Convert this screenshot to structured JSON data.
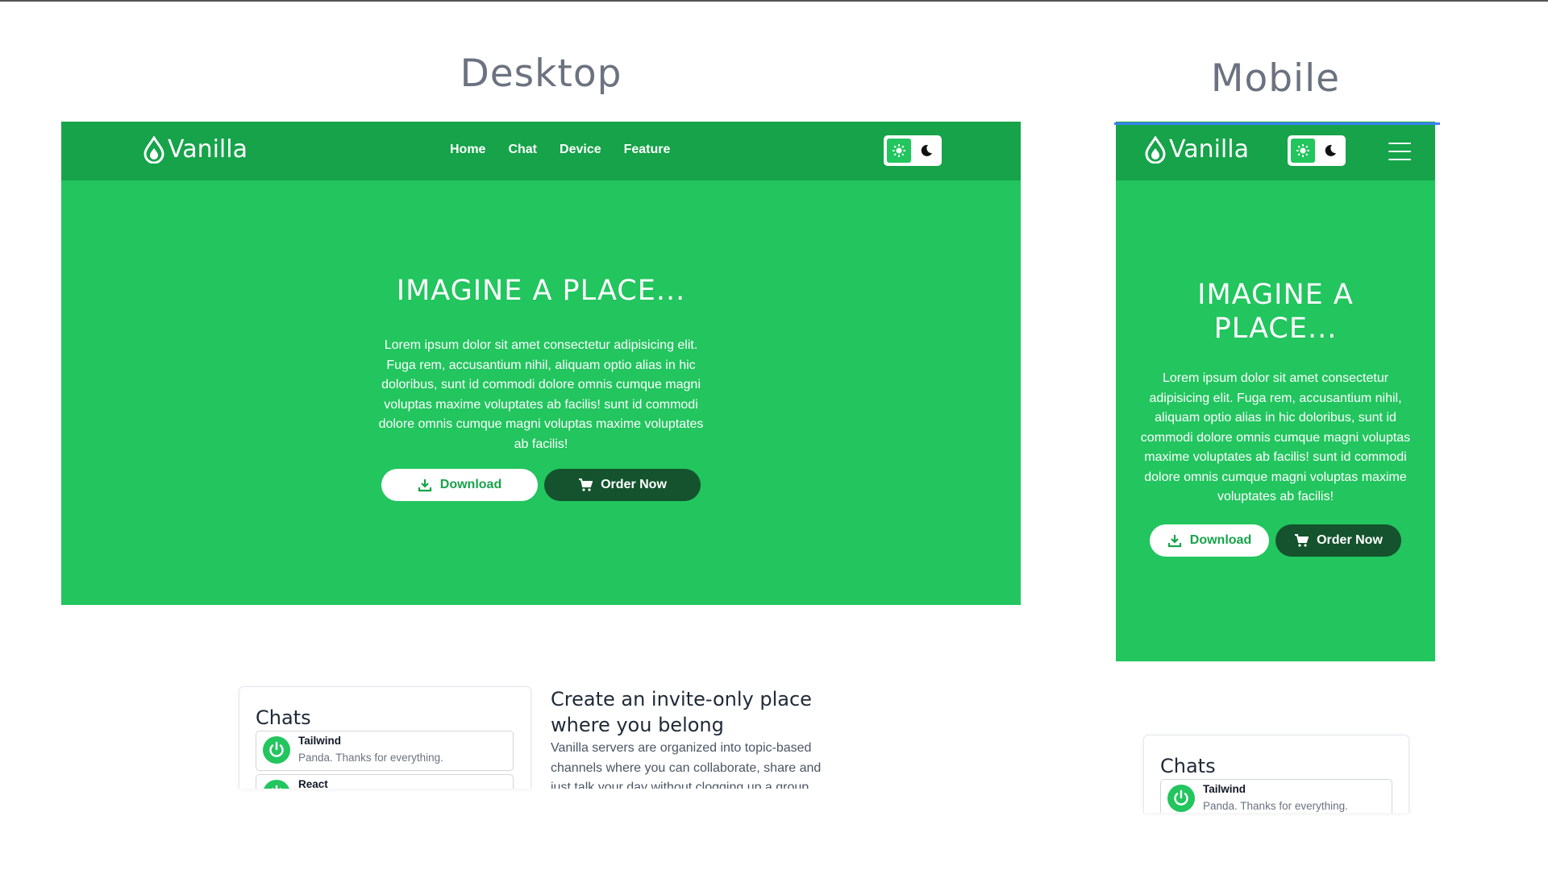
{
  "labels": {
    "desktop": "Desktop",
    "mobile": "Mobile"
  },
  "brand": {
    "name": "Vanilla",
    "logo_icon": "drop-icon"
  },
  "nav": {
    "links": [
      "Home",
      "Chat",
      "Device",
      "Feature"
    ]
  },
  "theme_toggle": {
    "light_icon": "sun-icon",
    "dark_icon": "moon-icon"
  },
  "hero": {
    "title": "IMAGINE A PLACE...",
    "text": "Lorem ipsum dolor sit amet consectetur adipisicing elit. Fuga rem, accusantium nihil, aliquam optio alias in hic doloribus, sunt id commodi dolore omnis cumque magni voluptas maxime voluptates ab facilis! sunt id commodi dolore omnis cumque magni voluptas maxime voluptates ab facilis!",
    "download_label": "Download",
    "order_label": "Order Now"
  },
  "chats": {
    "title": "Chats",
    "items": [
      {
        "name": "Tailwind",
        "message": "Panda. Thanks for everything."
      },
      {
        "name": "React",
        "message": ""
      }
    ]
  },
  "invite": {
    "title": "Create an invite-only place where you belong",
    "text": "Vanilla servers are organized into topic-based channels where you can collaborate, share and just talk your day without clogging up a group."
  },
  "colors": {
    "primary": "#22c55e",
    "nav": "#16a34a",
    "dark_button": "#14532d",
    "text_muted": "#6b7280"
  }
}
